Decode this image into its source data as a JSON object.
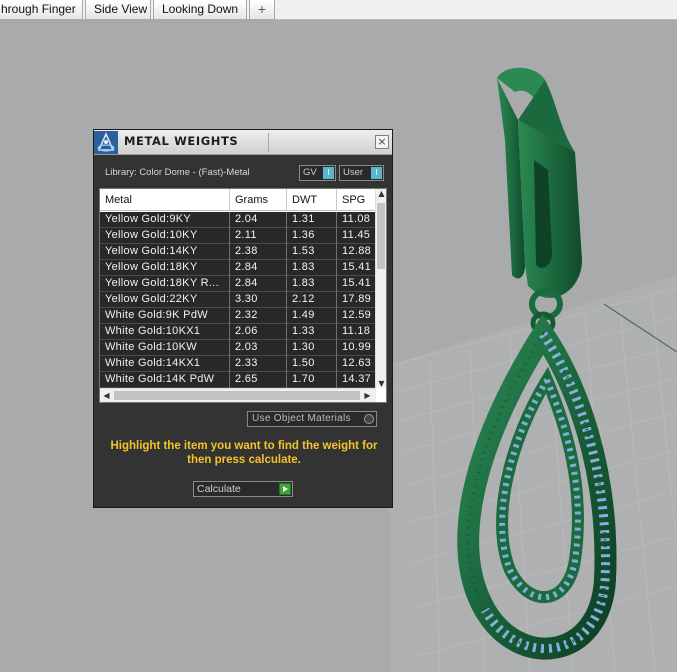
{
  "tabs": [
    {
      "label": "hrough Finger"
    },
    {
      "label": "Side View"
    },
    {
      "label": "Looking Down"
    }
  ],
  "add_tab_label": "+",
  "panel": {
    "title": "METAL WEIGHTS",
    "close_label": "×",
    "library_label": "Library: Color Dome - (Fast)-Metal",
    "gv_label": "GV",
    "user_label": "User",
    "toggle_glyph": "I",
    "table": {
      "headers": [
        "Metal",
        "Grams",
        "DWT",
        "SPG"
      ],
      "rows": [
        [
          "Yellow Gold:9KY",
          "2.04",
          "1.31",
          "11.08"
        ],
        [
          "Yellow Gold:10KY",
          "2.11",
          "1.36",
          "11.45"
        ],
        [
          "Yellow Gold:14KY",
          "2.38",
          "1.53",
          "12.88"
        ],
        [
          "Yellow Gold:18KY",
          "2.84",
          "1.83",
          "15.41"
        ],
        [
          "Yellow Gold:18KY R...",
          "2.84",
          "1.83",
          "15.41"
        ],
        [
          "Yellow Gold:22KY",
          "3.30",
          "2.12",
          "17.89"
        ],
        [
          "White Gold:9K PdW",
          "2.32",
          "1.49",
          "12.59"
        ],
        [
          "White Gold:10KX1",
          "2.06",
          "1.33",
          "11.18"
        ],
        [
          "White Gold:10KW",
          "2.03",
          "1.30",
          "10.99"
        ],
        [
          "White Gold:14KX1",
          "2.33",
          "1.50",
          "12.63"
        ],
        [
          "White Gold:14K PdW",
          "2.65",
          "1.70",
          "14.37"
        ]
      ]
    },
    "use_object_materials_label": "Use Object Materials",
    "instruction": "Highlight the item you want to find the weight for then press calculate.",
    "calculate_label": "Calculate"
  },
  "colors": {
    "metal_green": "#1f6e45",
    "gem_blue": "#8fb2e6",
    "instruction_yellow": "#f3c42a",
    "toggle_accent": "#59b8c9"
  }
}
